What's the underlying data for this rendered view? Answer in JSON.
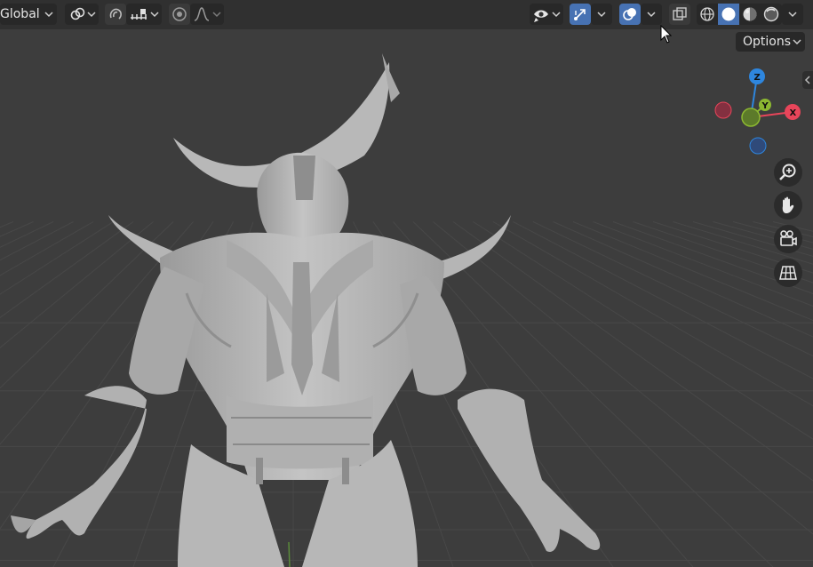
{
  "header": {
    "transform_orientation": "Global",
    "options_label": "Options"
  },
  "gizmo": {
    "axis_x": "X",
    "axis_y": "Y",
    "axis_z": "Z",
    "colors": {
      "x": "#e8455a",
      "y": "#8cb831",
      "z": "#2e86de"
    }
  },
  "nav_buttons": [
    "zoom-icon",
    "hand-pan-icon",
    "camera-icon",
    "grid-perspective-icon"
  ],
  "accent": "#4772b3",
  "background": "#3d3d3d"
}
